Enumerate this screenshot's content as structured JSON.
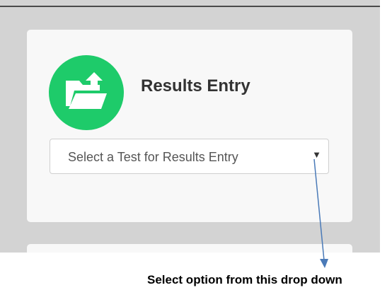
{
  "card": {
    "title": "Results Entry",
    "icon": "folder-upload-icon",
    "icon_color": "#1ecb6a"
  },
  "test_select": {
    "selected_value": "Select a Test for Results Entry",
    "arrow": "▼"
  },
  "annotation": {
    "text": "Select option from this drop down",
    "arrow_color": "#4a7ab8"
  },
  "colors": {
    "background": "#d3d3d3",
    "card": "#f8f8f8"
  }
}
